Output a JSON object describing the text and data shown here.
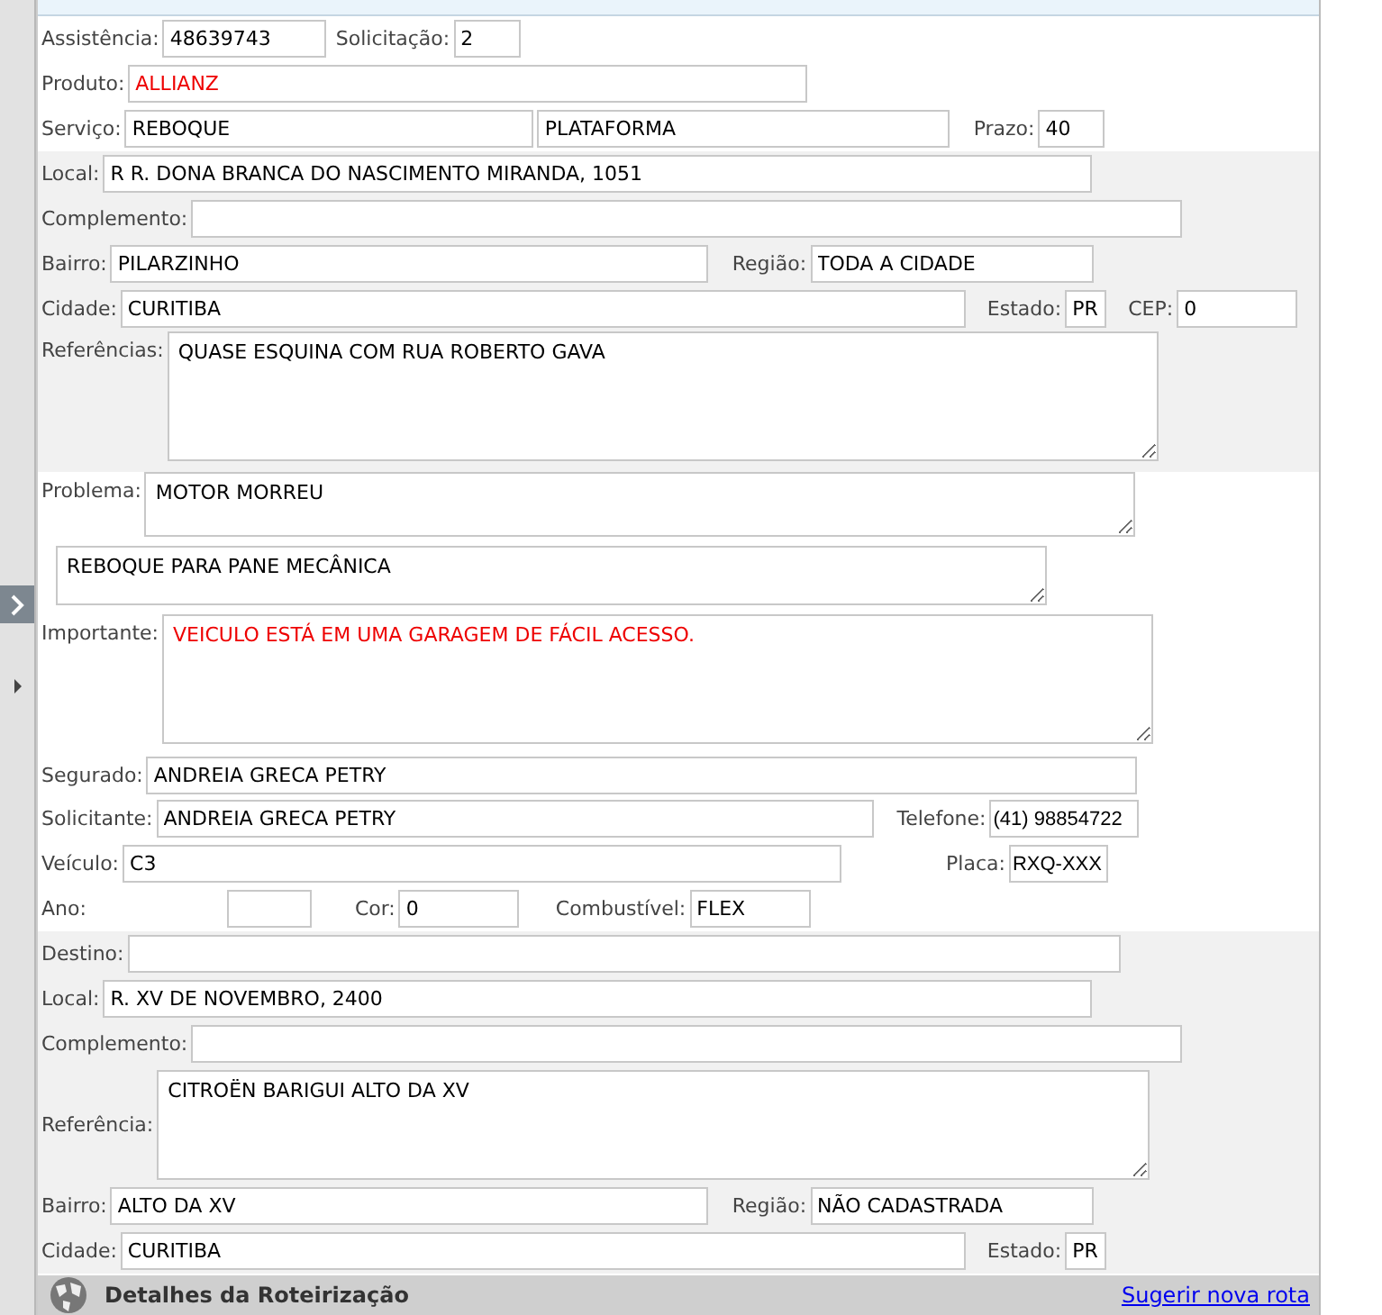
{
  "header": {
    "assistencia": {
      "label": "Assistência:",
      "value": "48639743"
    },
    "solicitacao": {
      "label": "Solicitação:",
      "value": "2"
    },
    "produto": {
      "label": "Produto:",
      "value": "ALLIANZ"
    },
    "servico": {
      "label": "Serviço:",
      "value": "REBOQUE",
      "value2": "PLATAFORMA"
    },
    "prazo": {
      "label": "Prazo:",
      "value": "40"
    }
  },
  "origem": {
    "local": {
      "label": "Local:",
      "value": "R R. DONA BRANCA DO NASCIMENTO MIRANDA, 1051"
    },
    "complemento": {
      "label": "Complemento:"
    },
    "bairro": {
      "label": "Bairro:",
      "value": "PILARZINHO"
    },
    "regiao": {
      "label": "Região:",
      "value": "TODA A CIDADE"
    },
    "cidade": {
      "label": "Cidade:",
      "value": "CURITIBA"
    },
    "estado": {
      "label": "Estado:",
      "value": "PR"
    },
    "cep": {
      "label": "CEP:",
      "value": "0"
    },
    "referencias": {
      "label": "Referências:",
      "value": "QUASE ESQUINA COM RUA ROBERTO GAVA"
    }
  },
  "ocorrencia": {
    "problema": {
      "label": "Problema:",
      "value": "MOTOR MORREU"
    },
    "descricao": "REBOQUE PARA PANE MECÂNICA",
    "importante": {
      "label": "Importante:",
      "value": "VEICULO ESTÁ EM UMA GARAGEM DE FÁCIL ACESSO."
    },
    "segurado": {
      "label": "Segurado:",
      "value": "ANDREIA GRECA PETRY"
    },
    "solicitante": {
      "label": "Solicitante:",
      "value": "ANDREIA GRECA PETRY"
    },
    "telefone": {
      "label": "Telefone:",
      "value": "(41) 98854722"
    },
    "veiculo": {
      "label": "Veículo:",
      "value": "C3"
    },
    "placa": {
      "label": "Placa:",
      "value": "RXQ-XXX"
    },
    "ano": {
      "label": "Ano:"
    },
    "cor": {
      "label": "Cor:",
      "value": "0"
    },
    "combustivel": {
      "label": "Combustível:",
      "value": "FLEX"
    }
  },
  "destino": {
    "destino": {
      "label": "Destino:"
    },
    "local": {
      "label": "Local:",
      "value": "R. XV DE NOVEMBRO, 2400"
    },
    "complemento": {
      "label": "Complemento:"
    },
    "referencia": {
      "label": "Referência:",
      "value": "CITROËN BARIGUI ALTO DA XV"
    },
    "bairro": {
      "label": "Bairro:",
      "value": "ALTO DA XV"
    },
    "regiao": {
      "label": "Região:",
      "value": "NÃO CADASTRADA"
    },
    "cidade": {
      "label": "Cidade:",
      "value": "CURITIBA"
    },
    "estado": {
      "label": "Estado:",
      "value": "PR"
    }
  },
  "footer": {
    "title": "Detalhes da Roteirização",
    "link": "Sugerir nova rota"
  }
}
